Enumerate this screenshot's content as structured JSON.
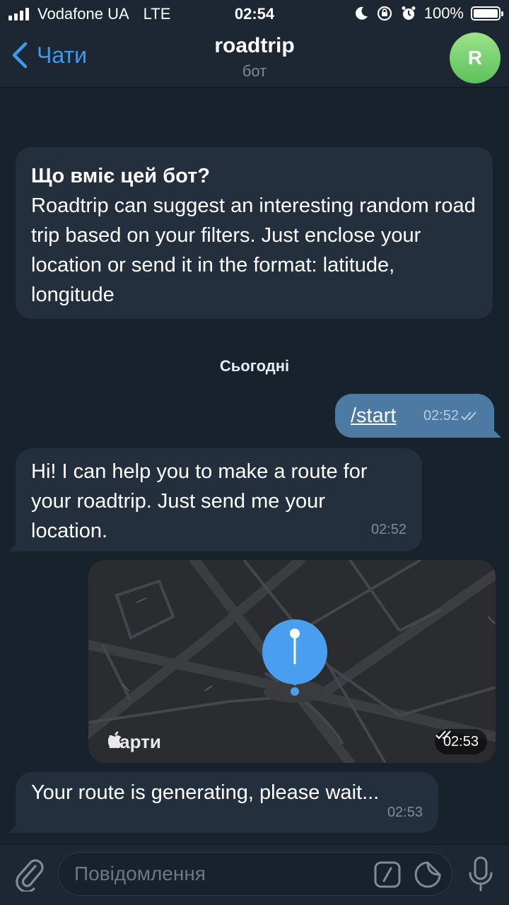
{
  "status_bar": {
    "carrier": "Vodafone UA",
    "network": "LTE",
    "time": "02:54",
    "battery": "100%",
    "battery_level": 1.0
  },
  "nav": {
    "back_label": "Чати",
    "title": "roadtrip",
    "subtitle": "бот",
    "avatar_initial": "R"
  },
  "info": {
    "title": "Що вміє цей бот?",
    "body": "Roadtrip can suggest an interesting random road trip based on your filters. Just enclose your location or send it in the format: latitude, longitude"
  },
  "date_separator": "Сьогодні",
  "messages": [
    {
      "direction": "out",
      "text": "/start",
      "time": "02:52"
    },
    {
      "direction": "in",
      "text": "Hi! I can help you to make a route for your roadtrip. Just send me your location.",
      "time": "02:52"
    },
    {
      "direction": "out",
      "type": "location",
      "provider": "Карти",
      "time": "02:53"
    },
    {
      "direction": "in",
      "text": "Your route is generating, please wait...",
      "time": "02:53"
    }
  ],
  "input": {
    "placeholder": "Повідомлення"
  },
  "icons": [
    "signal-icon",
    "moon-icon",
    "rotation-lock-icon",
    "alarm-icon",
    "battery-icon",
    "back-chevron-icon",
    "attach-icon",
    "command-icon",
    "sticker-icon",
    "microphone-icon",
    "map-pin-icon",
    "read-checks-icon",
    "apple-logo-icon"
  ],
  "colors": {
    "background": "#18222d",
    "bar": "#1c2733",
    "incoming_bubble": "#232f3d",
    "outgoing_bubble": "#4d7aa3",
    "accent": "#3d9bea",
    "pin": "#4a9ef0"
  }
}
